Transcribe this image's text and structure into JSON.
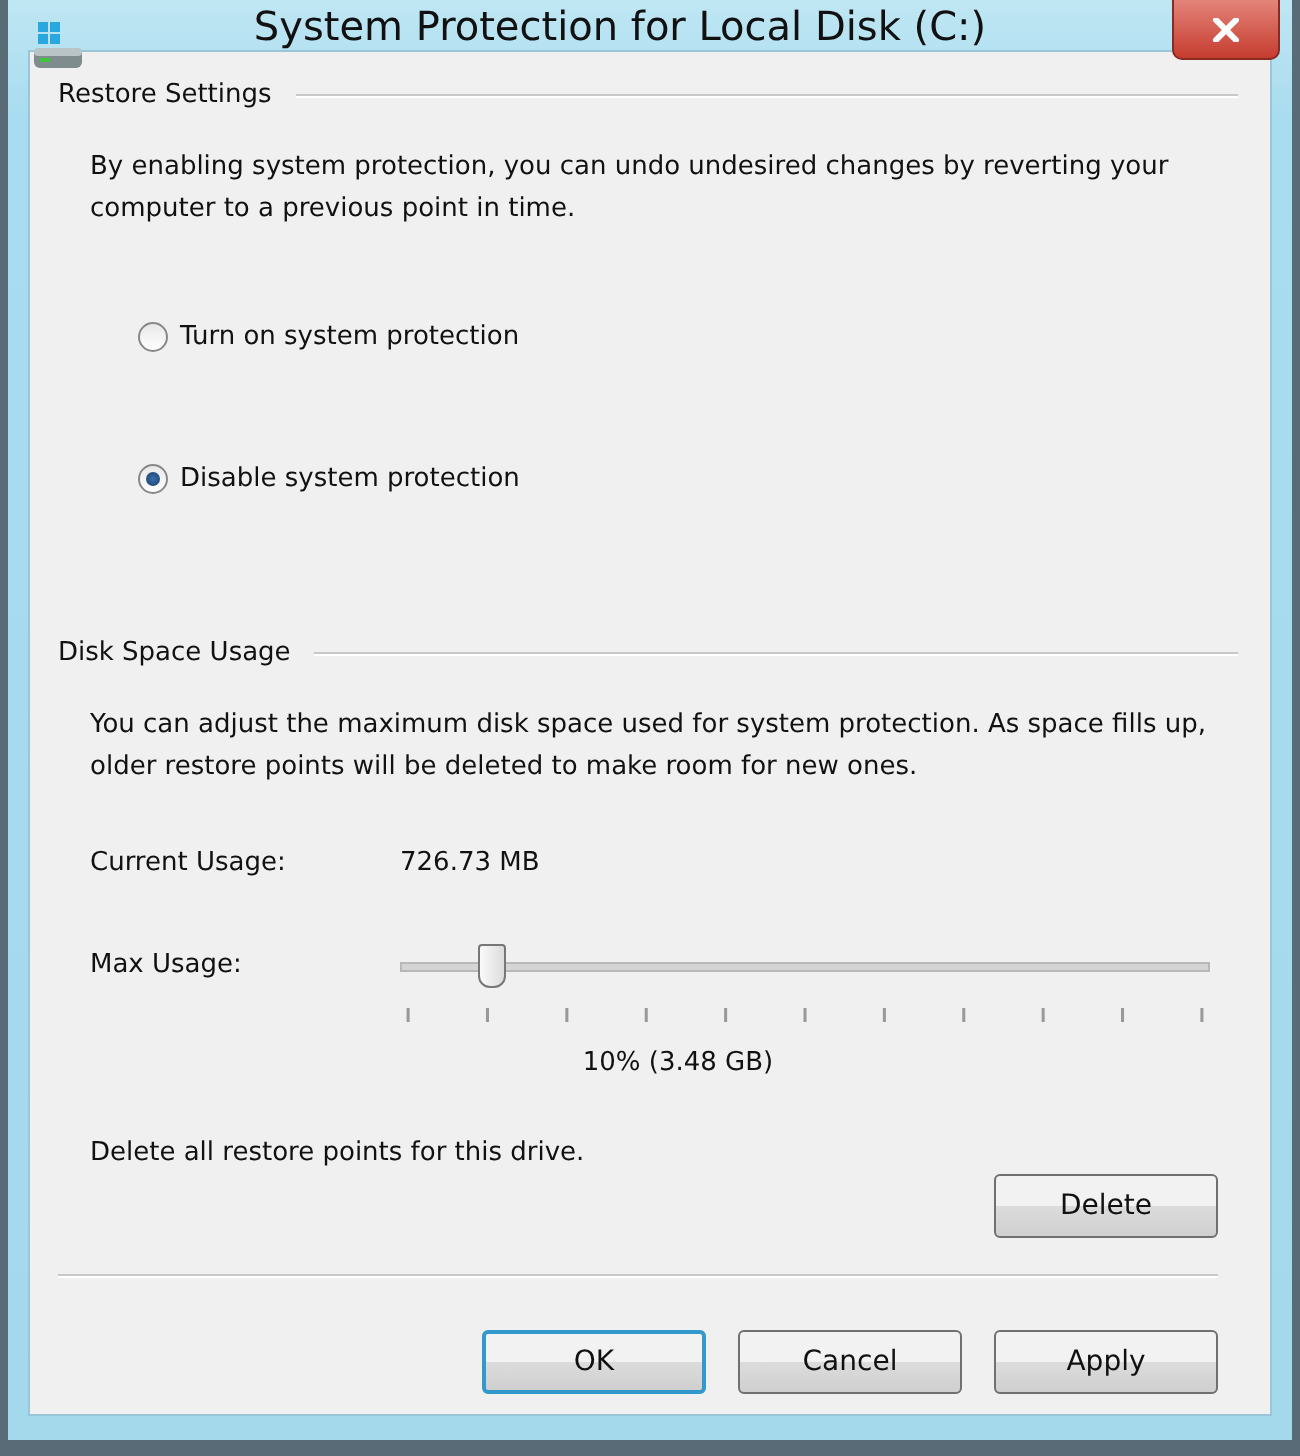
{
  "window": {
    "title": "System Protection for Local Disk (C:)"
  },
  "restore_settings": {
    "heading": "Restore Settings",
    "description": "By enabling system protection, you can undo undesired changes by reverting your computer to a previous point in time.",
    "options": [
      {
        "label": "Turn on system protection",
        "selected": false
      },
      {
        "label": "Disable system protection",
        "selected": true
      }
    ]
  },
  "disk_space_usage": {
    "heading": "Disk Space Usage",
    "description": "You can adjust the maximum disk space used for system protection. As space fills up, older restore points will be deleted to make room for new ones.",
    "current_usage_label": "Current Usage:",
    "current_usage_value": "726.73 MB",
    "max_usage_label": "Max Usage:",
    "max_usage_slider": {
      "level": 0.1
    },
    "max_usage_reading": "10% (3.48 GB)",
    "delete_text": "Delete all restore points for this drive.",
    "delete_button": "Delete"
  },
  "buttons": [
    {
      "label": "OK",
      "default": true
    },
    {
      "label": "Cancel",
      "default": false
    },
    {
      "label": "Apply",
      "default": false
    }
  ]
}
